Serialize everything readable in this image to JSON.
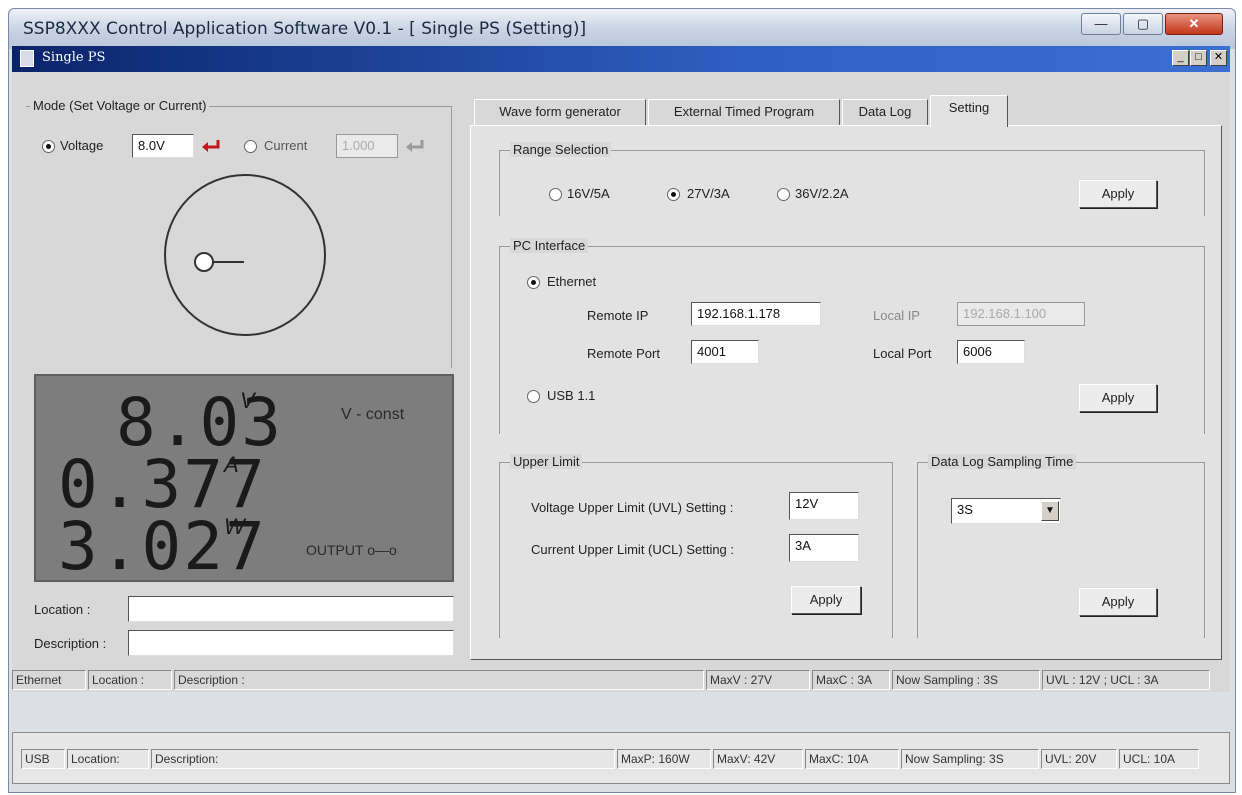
{
  "outer_window": {
    "title": "SSP8XXX Control Application Software V0.1 - [ Single PS (Setting)]",
    "minimize": "—",
    "maximize": "▢",
    "close": "✕"
  },
  "inner_window": {
    "title": "Single PS",
    "controls": [
      "_",
      "□",
      "✕"
    ]
  },
  "mode": {
    "label": "Mode (Set Voltage or Current)",
    "voltage_label": "Voltage",
    "voltage_value": "8.0V",
    "current_label": "Current",
    "current_value": "1.000",
    "voltage_selected": true
  },
  "display": {
    "voltage": "8.03",
    "voltage_unit": "V",
    "current": "0.377",
    "current_unit": "A",
    "power": "3.027",
    "power_unit": "W",
    "mode_status": "V - const",
    "output_status": "OUTPUT o—o"
  },
  "location": {
    "label": "Location :",
    "value": ""
  },
  "description": {
    "label": "Description :",
    "value": ""
  },
  "tabs": [
    {
      "label": "Wave form generator",
      "active": false
    },
    {
      "label": "External Timed Program",
      "active": false
    },
    {
      "label": "Data Log",
      "active": false
    },
    {
      "label": "Setting",
      "active": true
    }
  ],
  "range": {
    "title": "Range Selection",
    "options": [
      "16V/5A",
      "27V/3A",
      "36V/2.2A"
    ],
    "selected": "27V/3A",
    "apply": "Apply"
  },
  "pc_interface": {
    "title": "PC Interface",
    "ethernet_label": "Ethernet",
    "remote_ip_label": "Remote IP",
    "remote_ip": "192.168.1.178",
    "remote_port_label": "Remote Port",
    "remote_port": "4001",
    "local_ip_label": "Local IP",
    "local_ip": "192.168.1.100",
    "local_port_label": "Local Port",
    "local_port": "6006",
    "usb_label": "USB 1.1",
    "selected": "Ethernet",
    "apply": "Apply"
  },
  "upper_limit": {
    "title": "Upper Limit",
    "uvl_label": "Voltage Upper Limit (UVL) Setting :",
    "uvl_value": "12V",
    "ucl_label": "Current Upper Limit (UCL) Setting :",
    "ucl_value": "3A",
    "apply": "Apply"
  },
  "sampling": {
    "title": "Data Log Sampling Time",
    "value": "3S",
    "apply": "Apply"
  },
  "statusbar": {
    "interface": "Ethernet",
    "location": "Location :",
    "description": "Description :",
    "maxv": "MaxV : 27V",
    "maxc": "MaxC : 3A",
    "sampling": "Now Sampling : 3S",
    "limits": "UVL : 12V ; UCL : 3A"
  },
  "bottom_statusbar": {
    "interface": "USB",
    "location": "Location:",
    "description": "Description:",
    "maxp": "MaxP: 160W",
    "maxv": "MaxV: 42V",
    "maxc": "MaxC: 10A",
    "sampling": "Now Sampling: 3S",
    "uvl": "UVL: 20V",
    "ucl": "UCL: 10A"
  }
}
